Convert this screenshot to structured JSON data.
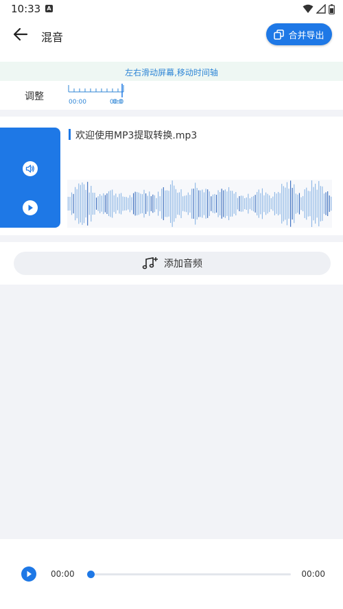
{
  "status": {
    "time": "10:33",
    "notif_letter": "A"
  },
  "header": {
    "title": "混音",
    "export_label": "合并导出"
  },
  "hint": "左右滑动屏幕,移动时间轴",
  "ruler": {
    "label": "调整",
    "start_time": "00:00",
    "end_time_a": "00:0",
    "end_time_b": "0:0"
  },
  "track": {
    "file_name": "欢迎使用MP3提取转换.mp3",
    "side_color": "#1e78e6"
  },
  "add_audio_label": "添加音频",
  "player": {
    "current_time": "00:00",
    "total_time": "00:00",
    "progress": 0
  },
  "colors": {
    "accent": "#1e78e6",
    "hint_text": "#2f86d6"
  },
  "icons": {
    "back": "arrow-left-icon",
    "export": "copy-icon",
    "volume": "volume-icon",
    "play": "play-icon",
    "add": "music-note-plus-icon"
  }
}
